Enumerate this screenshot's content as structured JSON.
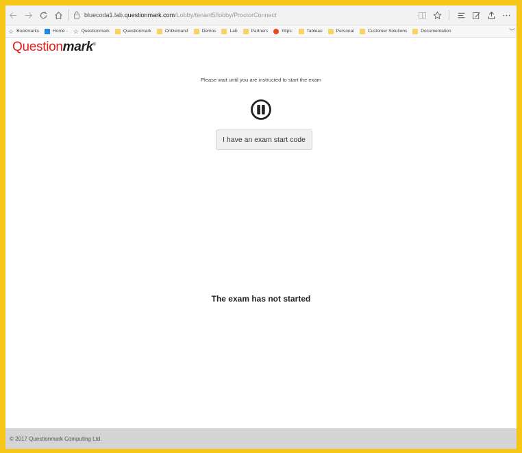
{
  "browser": {
    "url_host": "bluecoda1.lab.",
    "url_domain": "questionmark.com",
    "url_path": "/Lobby/tenant5/lobby/ProctorConnect"
  },
  "bookmarks": [
    {
      "label": "Bookmarks",
      "icon": "star-icon"
    },
    {
      "label": "Home -",
      "icon": "blue-square-icon"
    },
    {
      "label": "Questionmark",
      "icon": "star-icon"
    },
    {
      "label": "Questionmark",
      "icon": "folder-icon"
    },
    {
      "label": "OnDemand",
      "icon": "folder-icon"
    },
    {
      "label": "Demos",
      "icon": "folder-icon"
    },
    {
      "label": "Lab",
      "icon": "folder-icon"
    },
    {
      "label": "Partners",
      "icon": "folder-icon"
    },
    {
      "label": "https:",
      "icon": "globe-icon"
    },
    {
      "label": "Tableau",
      "icon": "folder-icon"
    },
    {
      "label": "Personal",
      "icon": "folder-icon"
    },
    {
      "label": "Customer Solutions",
      "icon": "folder-icon"
    },
    {
      "label": "Documentation",
      "icon": "folder-icon"
    }
  ],
  "logo": {
    "light": "Question",
    "bold": "mark",
    "mark": "®"
  },
  "page": {
    "wait_message": "Please wait until you are instructed to start the exam",
    "start_code_button": "I have an exam start code",
    "status_message": "The exam has not started"
  },
  "footer": {
    "copyright": "© 2017 Questionmark Computing Ltd."
  },
  "colors": {
    "frame": "#f5c518",
    "brand_red": "#e31d1a",
    "footer_bg": "#d4d4d4"
  }
}
